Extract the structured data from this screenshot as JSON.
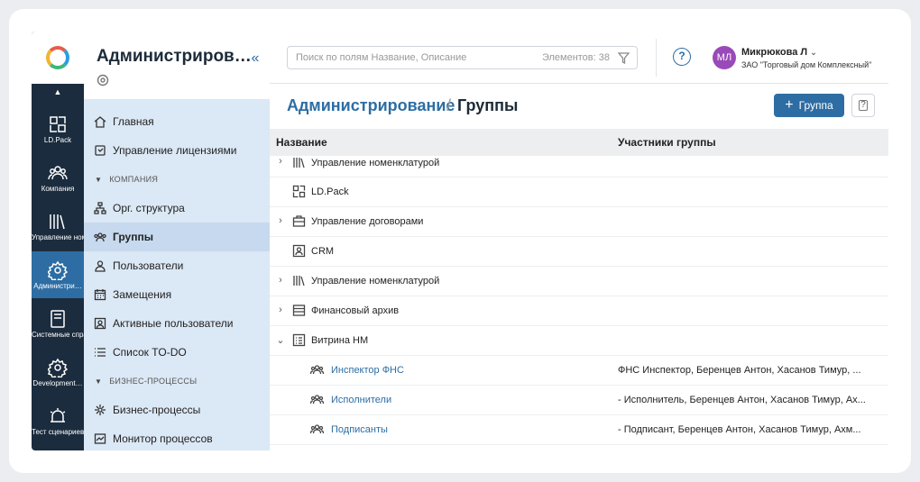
{
  "rail": {
    "items": [
      {
        "label": "LD.Pack",
        "icon": "ldpack-icon"
      },
      {
        "label": "Компания",
        "icon": "people-icon"
      },
      {
        "label": "Управление номенклату…",
        "icon": "books-icon"
      },
      {
        "label": "Администри…",
        "icon": "gear-icon",
        "active": true
      },
      {
        "label": "Системные справочники",
        "icon": "book-icon"
      },
      {
        "label": "Development…",
        "icon": "gear-icon"
      },
      {
        "label": "Тест сценариев ТМ",
        "icon": "alarm-icon"
      }
    ]
  },
  "nav": {
    "title": "Администриров…",
    "collapse": "«",
    "items": {
      "home": "Главная",
      "licenses": "Управление лицензиями",
      "section_company": "КОМПАНИЯ",
      "org": "Орг. структура",
      "groups": "Группы",
      "users": "Пользователи",
      "substitutions": "Замещения",
      "active_users": "Активные пользователи",
      "todo": "Список TO-DO",
      "section_bp": "БИЗНЕС-ПРОЦЕССЫ",
      "bp": "Бизнес-процессы",
      "monitor": "Монитор процессов"
    }
  },
  "topbar": {
    "search_placeholder": "Поиск по полям Название, Описание",
    "search_count": "Элементов: 38",
    "help": "?",
    "avatar_initials": "МЛ",
    "user_name": "Микрюкова Л",
    "user_org": "ЗАО \"Торговый дом Комплексный\""
  },
  "page": {
    "breadcrumb_root": "Администрирование",
    "breadcrumb_sep": "/",
    "breadcrumb_current": "Группы",
    "add_button": "Группа",
    "add_plus": "+",
    "help_small": "?"
  },
  "table": {
    "col_name": "Название",
    "col_members": "Участники группы",
    "rows": [
      {
        "name": "Управление номенклатурой",
        "expandable": true,
        "icon": "books-icon",
        "members": ""
      },
      {
        "name": "LD.Pack",
        "expandable": false,
        "icon": "ldpack-icon",
        "members": ""
      },
      {
        "name": "Управление договорами",
        "expandable": true,
        "icon": "briefcase-icon",
        "members": ""
      },
      {
        "name": "CRM",
        "expandable": false,
        "icon": "contact-icon",
        "members": ""
      },
      {
        "name": "Управление номенклатурой",
        "expandable": true,
        "icon": "books-icon",
        "members": ""
      },
      {
        "name": "Финансовый архив",
        "expandable": true,
        "icon": "archive-icon",
        "members": ""
      },
      {
        "name": "Витрина НМ",
        "expandable": true,
        "expanded": true,
        "icon": "list-icon",
        "members": ""
      },
      {
        "name": "Инспектор ФНС",
        "child": true,
        "icon": "group-icon",
        "members": "ФНС Инспектор, Беренцев Антон, Хасанов Тимур, ..."
      },
      {
        "name": "Исполнители",
        "child": true,
        "icon": "group-icon",
        "members": "- Исполнитель, Беренцев Антон, Хасанов Тимур, Ах..."
      },
      {
        "name": "Подписанты",
        "child": true,
        "icon": "group-icon",
        "members": "- Подписант, Беренцев Антон, Хасанов Тимур, Ахм..."
      }
    ]
  },
  "colors": {
    "accent": "#2d6da3",
    "rail_bg": "#1b2c3e",
    "nav_bg": "#dbe8f5",
    "avatar": "#9a4ab8"
  }
}
